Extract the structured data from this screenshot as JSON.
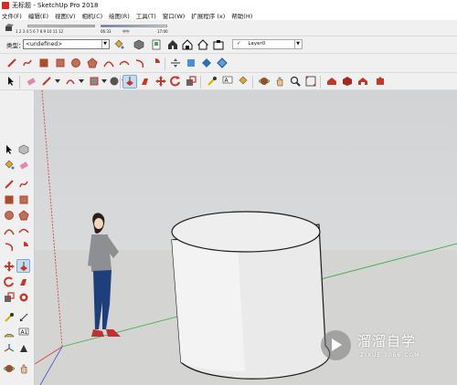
{
  "window": {
    "title": "无标题 - SketchUp Pro 2018"
  },
  "menu": {
    "items": [
      "文件(F)",
      "编辑(E)",
      "视图(V)",
      "相机(C)",
      "绘图(R)",
      "工具(T)",
      "窗口(W)",
      "扩展程序 (x)",
      "帮助(H)"
    ]
  },
  "shadow": {
    "month_scale": "1 2 3 4 5 6 7 8 9 10 11 12",
    "time_start": "06:33",
    "time_mid": "中午",
    "time_end": "17:00"
  },
  "styles": {
    "label": "类型：",
    "selected": "<undefined>"
  },
  "layer": {
    "checkmark": "✓",
    "selected": "Layer0"
  },
  "watermark": {
    "title": "溜溜自学",
    "url": "ZIXUE.3066.COM"
  },
  "colors": {
    "red_axis": "#c94545",
    "green_axis": "#3fae4b",
    "blue_axis": "#4a5fcf",
    "accent_icon_red": "#c0392b"
  }
}
